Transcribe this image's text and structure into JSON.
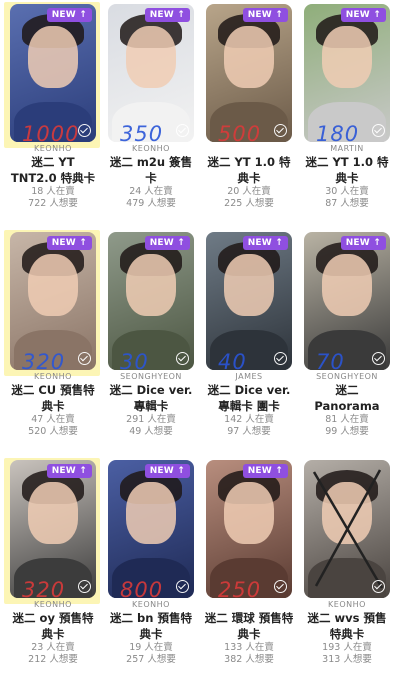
{
  "colors": {
    "badge": "#8f4fe0",
    "highlighter": "#f5e56b",
    "ink_red": "#d93a3a",
    "ink_blue": "#2a55d8"
  },
  "cards": [
    {
      "badge": "NEW ↑",
      "member": "KEONHO",
      "title": "迷二 YT TNT2.0 特典卡",
      "selling": "18 人在賣",
      "wanting": "722 人想要",
      "note": "1000",
      "note_color": "#d93a3a",
      "highlighted": true,
      "crossed": false,
      "bg": "#5a6fb0",
      "accent": "#2b3d7a"
    },
    {
      "badge": "NEW ↑",
      "member": "KEONHO",
      "title": "迷二 m2u 簽售卡",
      "selling": "24 人在賣",
      "wanting": "479 人想要",
      "note": "350",
      "note_color": "#2a55d8",
      "highlighted": false,
      "crossed": false,
      "bg": "#d9dce2",
      "accent": "#f2f2f2"
    },
    {
      "badge": "NEW ↑",
      "member": "",
      "title": "迷二 YT 1.0 特典卡",
      "selling": "20 人在賣",
      "wanting": "225 人想要",
      "note": "500",
      "note_color": "#d93a3a",
      "highlighted": false,
      "crossed": false,
      "bg": "#b8a58a",
      "accent": "#6b5a48"
    },
    {
      "badge": "NEW ↑",
      "member": "MARTIN",
      "title": "迷二 YT 1.0 特典卡",
      "selling": "30 人在賣",
      "wanting": "87 人想要",
      "note": "180",
      "note_color": "#2a55d8",
      "highlighted": false,
      "crossed": false,
      "bg": "#8fae7a",
      "accent": "#c9c9c9"
    },
    {
      "badge": "NEW ↑",
      "member": "KEONHO",
      "title": "迷二 CU 預售特典卡",
      "selling": "47 人在賣",
      "wanting": "520 人想要",
      "note": "320",
      "note_color": "#2a55d8",
      "highlighted": true,
      "crossed": false,
      "bg": "#c7b6a8",
      "accent": "#8a7466"
    },
    {
      "badge": "NEW ↑",
      "member": "SEONGHYEON",
      "title": "迷二 Dice ver. 專輯卡",
      "selling": "291 人在賣",
      "wanting": "49 人想要",
      "note": "30",
      "note_color": "#2a55d8",
      "highlighted": false,
      "crossed": false,
      "bg": "#8f9a8a",
      "accent": "#4c5642"
    },
    {
      "badge": "NEW ↑",
      "member": "JAMES",
      "title": "迷二 Dice ver. 專輯卡 團卡",
      "selling": "142 人在賣",
      "wanting": "97 人想要",
      "note": "40",
      "note_color": "#2a55d8",
      "highlighted": false,
      "crossed": false,
      "bg": "#6f7b86",
      "accent": "#2d333a"
    },
    {
      "badge": "NEW ↑",
      "member": "SEONGHYEON",
      "title": "迷二 Panorama A...",
      "selling": "81 人在賣",
      "wanting": "99 人想要",
      "note": "70",
      "note_color": "#2a55d8",
      "highlighted": false,
      "crossed": false,
      "bg": "#b9b3a4",
      "accent": "#3a3a3a"
    },
    {
      "badge": "NEW ↑",
      "member": "KEONHO",
      "title": "迷二 oy 預售特典卡",
      "selling": "23 人在賣",
      "wanting": "212 人想要",
      "note": "320",
      "note_color": "#d93a3a",
      "highlighted": true,
      "crossed": false,
      "bg": "#c9c3bd",
      "accent": "#3c3c3c"
    },
    {
      "badge": "NEW ↑",
      "member": "KEONHO",
      "title": "迷二 bn 預售特典卡",
      "selling": "19 人在賣",
      "wanting": "257 人想要",
      "note": "800",
      "note_color": "#d93a3a",
      "highlighted": false,
      "crossed": false,
      "bg": "#4b5fa3",
      "accent": "#1f2a55"
    },
    {
      "badge": "NEW ↑",
      "member": "",
      "title": "迷二 環球 預售特典卡",
      "selling": "133 人在賣",
      "wanting": "382 人想要",
      "note": "250",
      "note_color": "#d93a3a",
      "highlighted": false,
      "crossed": false,
      "bg": "#b88e7e",
      "accent": "#5a3b32"
    },
    {
      "badge": "",
      "member": "KEONHO",
      "title": "迷二 wvs 預售特典卡",
      "selling": "193 人在賣",
      "wanting": "313 人想要",
      "note": "",
      "note_color": "#222222",
      "highlighted": false,
      "crossed": true,
      "bg": "#b4aea7",
      "accent": "#4a4440"
    }
  ]
}
